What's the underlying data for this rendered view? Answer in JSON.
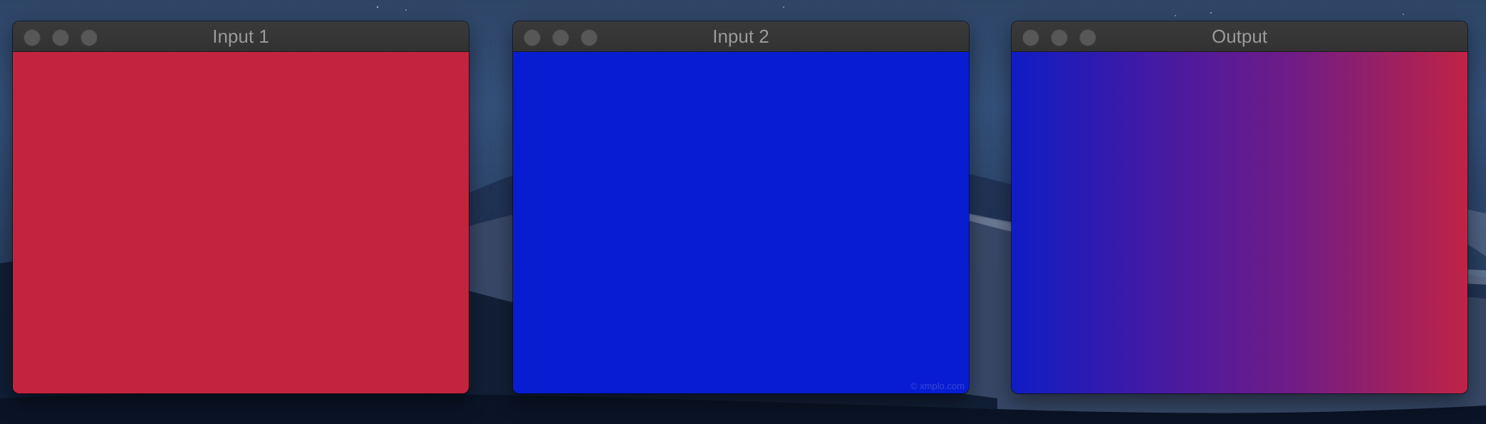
{
  "windows": [
    {
      "title": "Input 1",
      "fill": "solid",
      "color": "#c4233e",
      "watermark": ""
    },
    {
      "title": "Input 2",
      "fill": "solid",
      "color": "#081cd2",
      "watermark": "© xmplo.com"
    },
    {
      "title": "Output",
      "fill": "gradient-left-to-right",
      "gradient_start": "#0f1cc4",
      "gradient_end": "#c02345",
      "watermark": ""
    }
  ],
  "colors": {
    "titlebar": "#333333",
    "title_text": "#9a9a9a",
    "traffic_light": "#575757"
  }
}
